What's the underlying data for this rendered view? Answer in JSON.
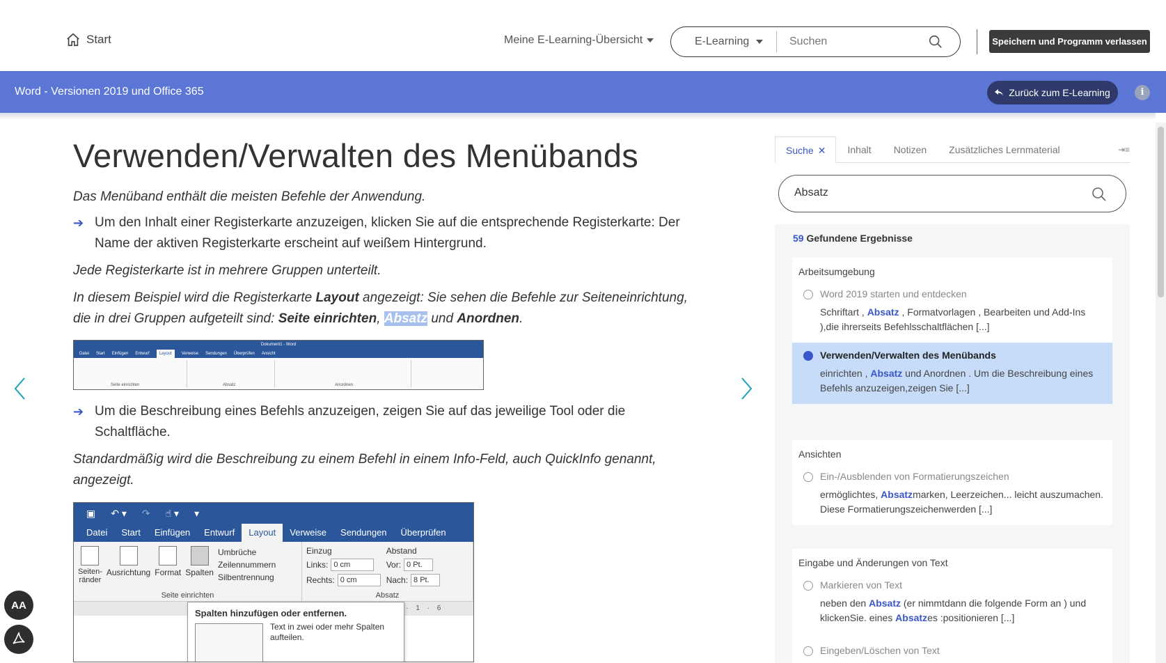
{
  "topnav": {
    "start_label": "Start",
    "overview_label": "Meine E-Learning-Übersicht",
    "search_scope": "E-Learning",
    "search_placeholder": "Suchen",
    "save_button": "Speichern und Programm verlassen"
  },
  "course": {
    "title": "Word - Versionen 2019 und Office 365",
    "back_button": "Zurück zum E-Learning",
    "info_label": "i"
  },
  "content": {
    "page_title": "Verwenden/Verwalten des Menübands",
    "intro": "Das Menüband enthält die meisten Befehle der Anwendung.",
    "bullet1": "Um den Inhalt einer Registerkarte anzuzeigen, klicken Sie auf die entsprechende Registerkarte: Der Name der aktiven Registerkarte erscheint auf weißem Hintergrund.",
    "para2": "Jede Registerkarte ist in mehrere Gruppen unterteilt.",
    "para3_a": "In diesem Beispiel wird die Registerkarte ",
    "para3_b": "Layout",
    "para3_c": " angezeigt: Sie sehen die Befehle zur Seiteneinrichtung, die in drei Gruppen aufgeteilt sind: ",
    "para3_d": "Seite einrichten",
    "para3_e": ", ",
    "para3_f": "Absatz",
    "para3_g": " und ",
    "para3_h": "Anordnen",
    "para3_i": ".",
    "bullet2": "Um die Beschreibung eines Befehls anzuzeigen, zeigen Sie auf das jeweilige Tool oder die Schaltfläche.",
    "para4": "Standardmäßig wird die Beschreibung zu einem Befehl in einem Info-Feld, auch QuickInfo genannt, angezeigt."
  },
  "ribbon_small": {
    "title": "Dokument1 - Word",
    "tabs": [
      "Datei",
      "Start",
      "Einfügen",
      "Entwurf",
      "Layout",
      "Verweise",
      "Sendungen",
      "Überprüfen",
      "Ansicht"
    ],
    "groups": [
      "Seite einrichten",
      "Absatz",
      "Anordnen"
    ]
  },
  "ribbon_large": {
    "tabs": [
      "Datei",
      "Start",
      "Einfügen",
      "Entwurf",
      "Layout",
      "Verweise",
      "Sendungen",
      "Überprüfen"
    ],
    "active_tab": "Layout",
    "buttons": [
      "Seiten-\nränder",
      "Ausrichtung",
      "Format",
      "Spalten"
    ],
    "small_buttons": [
      "Umbrüche",
      "Zeilennummern",
      "Silbentrennung"
    ],
    "group1_label": "Seite einrichten",
    "group2_label": "Absatz",
    "einzug_label": "Einzug",
    "abstand_label": "Abstand",
    "links_label": "Links:",
    "rechts_label": "Rechts:",
    "vor_label": "Vor:",
    "nach_label": "Nach:",
    "links_value": "0 cm",
    "rechts_value": "0 cm",
    "vor_value": "0 Pt.",
    "nach_value": "8 Pt.",
    "ruler": "4 · 1 · 5 · 1 · 6",
    "tooltip_title": "Spalten hinzufügen oder entfernen.",
    "tooltip_text": "Text in zwei oder mehr Spalten aufteilen."
  },
  "panel": {
    "tabs": [
      "Suche",
      "Inhalt",
      "Notizen",
      "Zusätzliches Lernmaterial"
    ],
    "search_value": "Absatz",
    "result_count": "59",
    "result_label": "Gefundene Ergebnisse",
    "groups": [
      {
        "title": "Arbeitsumgebung",
        "items": [
          {
            "title": "Word 2019 starten und entdecken",
            "s1": "Schriftart , ",
            "k1": "Absatz",
            "s2": " , Formatvorlagen , Bearbeiten und Add-Ins ),die ihrerseits Befehlsschaltflächen [...]",
            "k2": "",
            "s3": ""
          },
          {
            "title": "Verwenden/Verwalten des Menübands",
            "s1": "einrichten , ",
            "k1": "Absatz",
            "s2": " und Anordnen . Um die Beschreibung eines Befehls anzuzeigen,zeigen Sie [...]",
            "k2": "",
            "s3": ""
          }
        ]
      },
      {
        "title": "Ansichten",
        "items": [
          {
            "title": "Ein-/Ausblenden von Formatierungszeichen",
            "s1": "ermöglichtes, ",
            "k1": "Absatz",
            "s2": "marken, Leerzeichen... leicht auszumachen. Diese Formatierungszeichenwerden [...]",
            "k2": "",
            "s3": ""
          }
        ]
      },
      {
        "title": "Eingabe und Änderungen von Text",
        "items": [
          {
            "title": "Markieren von Text",
            "s1": "neben den ",
            "k1": "Absatz",
            "s2": " (er nimmtdann die folgende Form an ) und klickenSie. eines ",
            "k2": "Absatz",
            "s3": "es :positionieren [...]"
          },
          {
            "title": "Eingeben/Löschen von Text",
            "s1": "",
            "k1": "",
            "s2": "",
            "k2": "",
            "s3": ""
          }
        ]
      }
    ]
  },
  "tools": {
    "font_tool": "AA"
  },
  "colors": {
    "accent": "#5b76d4",
    "link": "#3a56c8",
    "dark_button": "#3b3b3b",
    "selected_result": "#c6dcf9",
    "word_blue": "#2b579a"
  }
}
